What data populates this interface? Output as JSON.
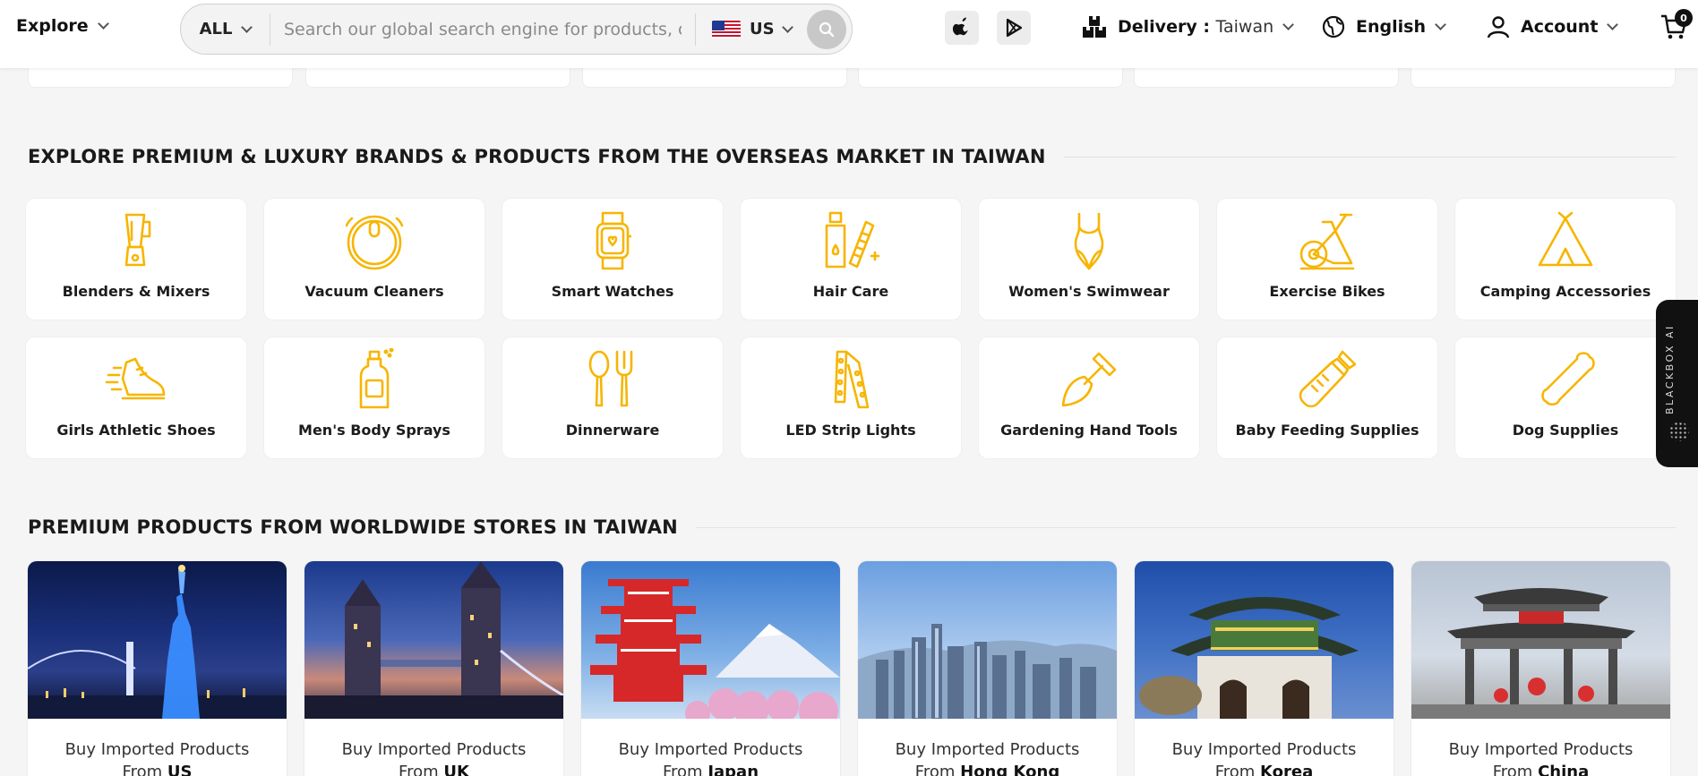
{
  "header": {
    "explore_label": "Explore",
    "search": {
      "category": "ALL",
      "placeholder": "Search our global search engine for products, categories",
      "country": "US"
    },
    "delivery_label": "Delivery : ",
    "delivery_value": "Taiwan",
    "language": "English",
    "account": "Account",
    "cart_count": "0"
  },
  "brands_section": {
    "title": "EXPLORE PREMIUM & LUXURY BRANDS & PRODUCTS FROM THE OVERSEAS MARKET IN TAIWAN",
    "categories": [
      {
        "label": "Blenders & Mixers",
        "icon": "blender-icon"
      },
      {
        "label": "Vacuum Cleaners",
        "icon": "robot-vacuum-icon"
      },
      {
        "label": "Smart Watches",
        "icon": "smartwatch-icon"
      },
      {
        "label": "Hair Care",
        "icon": "hair-care-icon"
      },
      {
        "label": "Women's Swimwear",
        "icon": "swimsuit-icon"
      },
      {
        "label": "Exercise Bikes",
        "icon": "exercise-bike-icon"
      },
      {
        "label": "Camping Accessories",
        "icon": "tent-icon"
      },
      {
        "label": "Girls Athletic Shoes",
        "icon": "running-shoe-icon"
      },
      {
        "label": "Men's Body Sprays",
        "icon": "spray-bottle-icon"
      },
      {
        "label": "Dinnerware",
        "icon": "spoon-fork-icon"
      },
      {
        "label": "LED Strip Lights",
        "icon": "led-strip-icon"
      },
      {
        "label": "Gardening Hand Tools",
        "icon": "shovel-icon"
      },
      {
        "label": "Baby Feeding Supplies",
        "icon": "baby-bottle-icon"
      },
      {
        "label": "Dog Supplies",
        "icon": "bone-icon"
      }
    ]
  },
  "stores_section": {
    "title": "PREMIUM PRODUCTS FROM WORLDWIDE STORES IN TAIWAN",
    "prefix": "Buy Imported Products",
    "from": "From",
    "countries": [
      "US",
      "UK",
      "Japan",
      "Hong Kong",
      "Korea",
      "China"
    ]
  },
  "side_tab": {
    "label": "BLACKBOX AI"
  },
  "colors": {
    "accent": "#f7b500",
    "text": "#1a1a1a",
    "background": "#f5f5f5"
  }
}
